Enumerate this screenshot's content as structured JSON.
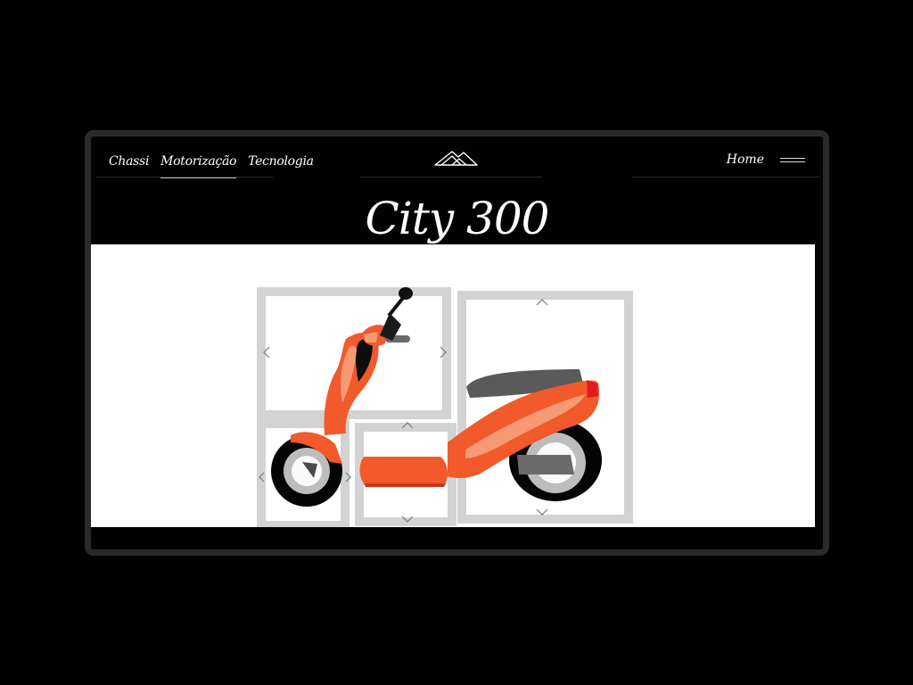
{
  "nav": {
    "items": [
      {
        "label": "Chassi"
      },
      {
        "label": "Motorização",
        "active": true
      },
      {
        "label": "Tecnologia"
      }
    ],
    "home_label": "Home",
    "logo_icon": "mountain-logo-icon",
    "menu_icon": "hamburger-menu-icon"
  },
  "page": {
    "title": "City 300"
  },
  "puzzle": {
    "image_subject": "orange scooter",
    "tile_frame_color": "#d3d3d3",
    "controls": [
      "left-arrow",
      "right-arrow",
      "up-arrow",
      "down-arrow"
    ]
  },
  "colors": {
    "background": "#000000",
    "frame": "#2a2a2a",
    "scooter_orange": "#f2592b",
    "scooter_highlight": "#f59a72",
    "brake_light": "#e11c1c"
  }
}
